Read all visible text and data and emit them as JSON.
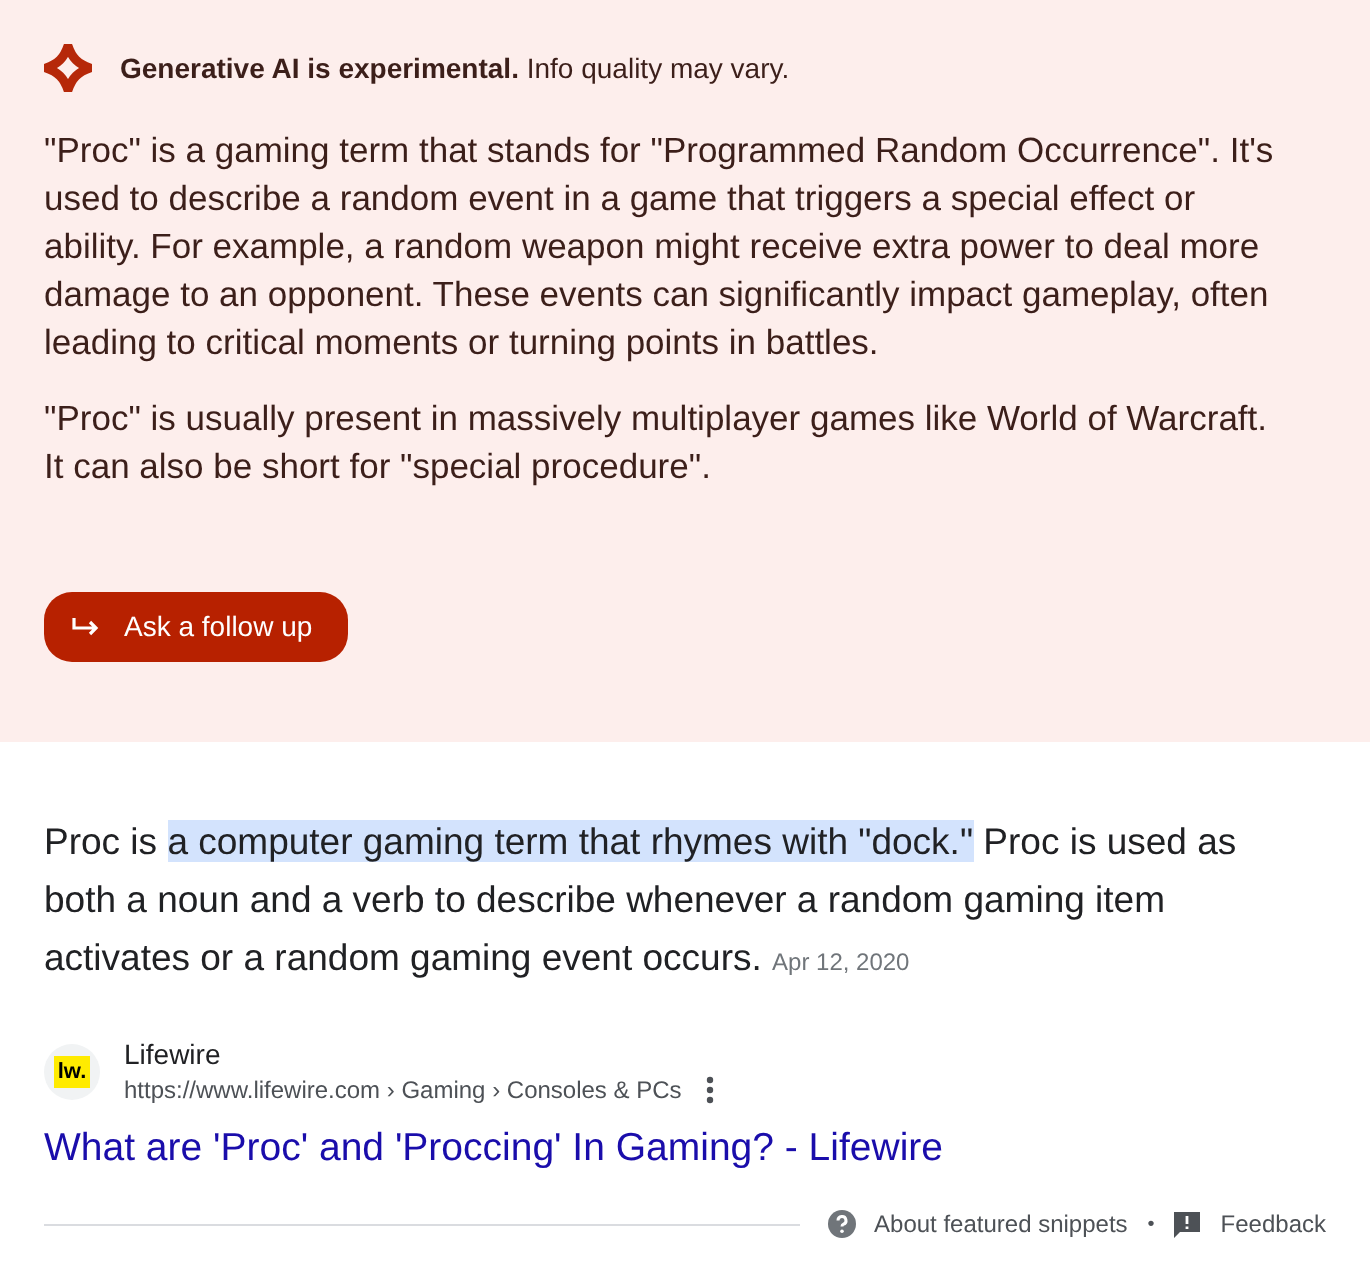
{
  "ai_overview": {
    "notice": "**Generative AI is experimental.** Info quality may vary.",
    "paragraphs": [
      "\"Proc\" is a gaming term that stands for \"Programmed Random Occurrence\". It's used to describe a random event in a game that triggers a special effect or ability. For example, a random weapon might receive extra power to deal more damage to an opponent. These events can significantly impact gameplay, often leading to critical moments or turning points in battles.",
      "\"Proc\" is usually present in massively multiplayer games like World of Warcraft. It can also be short for \"special procedure\"."
    ],
    "follow_up_button": "Ask a follow up"
  },
  "featured_snippet": {
    "text_before": "Proc is ",
    "text_highlighted": "a computer gaming term that rhymes with \"dock.\"",
    "text_after": " Proc is used as both a noun and a verb to describe whenever a random gaming item activates or a random gaming event occurs.",
    "date": "Apr 12, 2020",
    "source": {
      "favicon_text": "lw.",
      "name": "Lifewire",
      "url": "https://www.lifewire.com",
      "breadcrumb_separator": "›",
      "breadcrumbs": [
        "Gaming",
        "Consoles & PCs"
      ]
    },
    "title": "What are 'Proc' and 'Proccing' In Gaming? - Lifewire"
  },
  "footer": {
    "about": "About featured snippets",
    "separator": "•",
    "feedback": "Feedback"
  }
}
